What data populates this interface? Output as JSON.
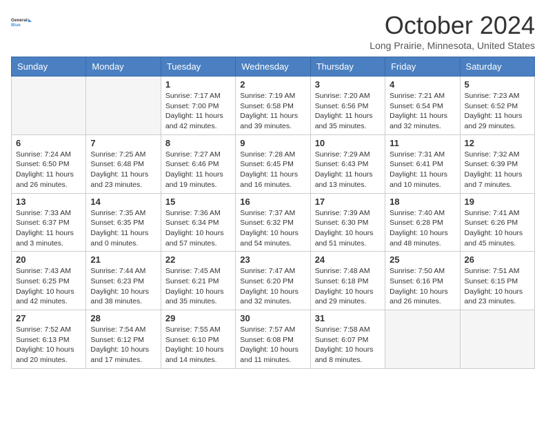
{
  "header": {
    "logo_line1": "General",
    "logo_line2": "Blue",
    "month_title": "October 2024",
    "location": "Long Prairie, Minnesota, United States"
  },
  "days_of_week": [
    "Sunday",
    "Monday",
    "Tuesday",
    "Wednesday",
    "Thursday",
    "Friday",
    "Saturday"
  ],
  "weeks": [
    [
      {
        "day": "",
        "empty": true
      },
      {
        "day": "",
        "empty": true
      },
      {
        "day": "1",
        "sunrise": "Sunrise: 7:17 AM",
        "sunset": "Sunset: 7:00 PM",
        "daylight": "Daylight: 11 hours and 42 minutes."
      },
      {
        "day": "2",
        "sunrise": "Sunrise: 7:19 AM",
        "sunset": "Sunset: 6:58 PM",
        "daylight": "Daylight: 11 hours and 39 minutes."
      },
      {
        "day": "3",
        "sunrise": "Sunrise: 7:20 AM",
        "sunset": "Sunset: 6:56 PM",
        "daylight": "Daylight: 11 hours and 35 minutes."
      },
      {
        "day": "4",
        "sunrise": "Sunrise: 7:21 AM",
        "sunset": "Sunset: 6:54 PM",
        "daylight": "Daylight: 11 hours and 32 minutes."
      },
      {
        "day": "5",
        "sunrise": "Sunrise: 7:23 AM",
        "sunset": "Sunset: 6:52 PM",
        "daylight": "Daylight: 11 hours and 29 minutes."
      }
    ],
    [
      {
        "day": "6",
        "sunrise": "Sunrise: 7:24 AM",
        "sunset": "Sunset: 6:50 PM",
        "daylight": "Daylight: 11 hours and 26 minutes."
      },
      {
        "day": "7",
        "sunrise": "Sunrise: 7:25 AM",
        "sunset": "Sunset: 6:48 PM",
        "daylight": "Daylight: 11 hours and 23 minutes."
      },
      {
        "day": "8",
        "sunrise": "Sunrise: 7:27 AM",
        "sunset": "Sunset: 6:46 PM",
        "daylight": "Daylight: 11 hours and 19 minutes."
      },
      {
        "day": "9",
        "sunrise": "Sunrise: 7:28 AM",
        "sunset": "Sunset: 6:45 PM",
        "daylight": "Daylight: 11 hours and 16 minutes."
      },
      {
        "day": "10",
        "sunrise": "Sunrise: 7:29 AM",
        "sunset": "Sunset: 6:43 PM",
        "daylight": "Daylight: 11 hours and 13 minutes."
      },
      {
        "day": "11",
        "sunrise": "Sunrise: 7:31 AM",
        "sunset": "Sunset: 6:41 PM",
        "daylight": "Daylight: 11 hours and 10 minutes."
      },
      {
        "day": "12",
        "sunrise": "Sunrise: 7:32 AM",
        "sunset": "Sunset: 6:39 PM",
        "daylight": "Daylight: 11 hours and 7 minutes."
      }
    ],
    [
      {
        "day": "13",
        "sunrise": "Sunrise: 7:33 AM",
        "sunset": "Sunset: 6:37 PM",
        "daylight": "Daylight: 11 hours and 3 minutes."
      },
      {
        "day": "14",
        "sunrise": "Sunrise: 7:35 AM",
        "sunset": "Sunset: 6:35 PM",
        "daylight": "Daylight: 11 hours and 0 minutes."
      },
      {
        "day": "15",
        "sunrise": "Sunrise: 7:36 AM",
        "sunset": "Sunset: 6:34 PM",
        "daylight": "Daylight: 10 hours and 57 minutes."
      },
      {
        "day": "16",
        "sunrise": "Sunrise: 7:37 AM",
        "sunset": "Sunset: 6:32 PM",
        "daylight": "Daylight: 10 hours and 54 minutes."
      },
      {
        "day": "17",
        "sunrise": "Sunrise: 7:39 AM",
        "sunset": "Sunset: 6:30 PM",
        "daylight": "Daylight: 10 hours and 51 minutes."
      },
      {
        "day": "18",
        "sunrise": "Sunrise: 7:40 AM",
        "sunset": "Sunset: 6:28 PM",
        "daylight": "Daylight: 10 hours and 48 minutes."
      },
      {
        "day": "19",
        "sunrise": "Sunrise: 7:41 AM",
        "sunset": "Sunset: 6:26 PM",
        "daylight": "Daylight: 10 hours and 45 minutes."
      }
    ],
    [
      {
        "day": "20",
        "sunrise": "Sunrise: 7:43 AM",
        "sunset": "Sunset: 6:25 PM",
        "daylight": "Daylight: 10 hours and 42 minutes."
      },
      {
        "day": "21",
        "sunrise": "Sunrise: 7:44 AM",
        "sunset": "Sunset: 6:23 PM",
        "daylight": "Daylight: 10 hours and 38 minutes."
      },
      {
        "day": "22",
        "sunrise": "Sunrise: 7:45 AM",
        "sunset": "Sunset: 6:21 PM",
        "daylight": "Daylight: 10 hours and 35 minutes."
      },
      {
        "day": "23",
        "sunrise": "Sunrise: 7:47 AM",
        "sunset": "Sunset: 6:20 PM",
        "daylight": "Daylight: 10 hours and 32 minutes."
      },
      {
        "day": "24",
        "sunrise": "Sunrise: 7:48 AM",
        "sunset": "Sunset: 6:18 PM",
        "daylight": "Daylight: 10 hours and 29 minutes."
      },
      {
        "day": "25",
        "sunrise": "Sunrise: 7:50 AM",
        "sunset": "Sunset: 6:16 PM",
        "daylight": "Daylight: 10 hours and 26 minutes."
      },
      {
        "day": "26",
        "sunrise": "Sunrise: 7:51 AM",
        "sunset": "Sunset: 6:15 PM",
        "daylight": "Daylight: 10 hours and 23 minutes."
      }
    ],
    [
      {
        "day": "27",
        "sunrise": "Sunrise: 7:52 AM",
        "sunset": "Sunset: 6:13 PM",
        "daylight": "Daylight: 10 hours and 20 minutes."
      },
      {
        "day": "28",
        "sunrise": "Sunrise: 7:54 AM",
        "sunset": "Sunset: 6:12 PM",
        "daylight": "Daylight: 10 hours and 17 minutes."
      },
      {
        "day": "29",
        "sunrise": "Sunrise: 7:55 AM",
        "sunset": "Sunset: 6:10 PM",
        "daylight": "Daylight: 10 hours and 14 minutes."
      },
      {
        "day": "30",
        "sunrise": "Sunrise: 7:57 AM",
        "sunset": "Sunset: 6:08 PM",
        "daylight": "Daylight: 10 hours and 11 minutes."
      },
      {
        "day": "31",
        "sunrise": "Sunrise: 7:58 AM",
        "sunset": "Sunset: 6:07 PM",
        "daylight": "Daylight: 10 hours and 8 minutes."
      },
      {
        "day": "",
        "empty": true
      },
      {
        "day": "",
        "empty": true
      }
    ]
  ]
}
